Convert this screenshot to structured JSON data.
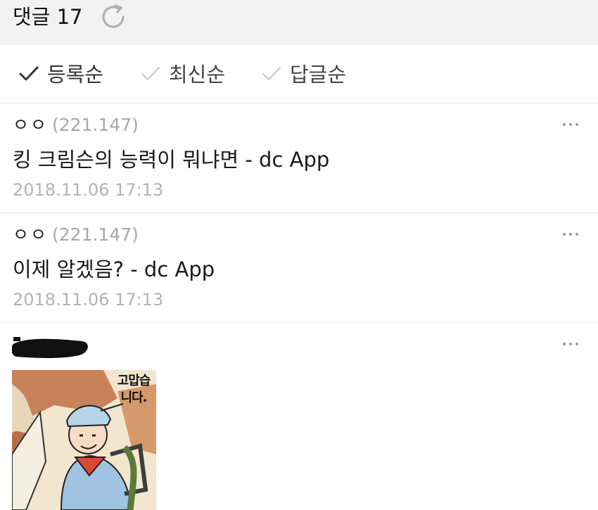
{
  "header": {
    "title": "댓글 17",
    "refresh_icon": "refresh-icon"
  },
  "sort": {
    "items": [
      {
        "label": "등록순",
        "active": true
      },
      {
        "label": "최신순",
        "active": false
      },
      {
        "label": "답글순",
        "active": false
      }
    ]
  },
  "comments": [
    {
      "author": "ㅇㅇ",
      "ip": "(221.147)",
      "text": "킹 크림슨의 능력이 뭐냐면  - dc App",
      "date": "2018.11.06 17:13",
      "more_icon": "more-icon"
    },
    {
      "author": "ㅇㅇ",
      "ip": "(221.147)",
      "text": "이제 알겠음?  - dc App",
      "date": "2018.11.06 17:13",
      "more_icon": "more-icon"
    },
    {
      "author_redacted": true,
      "image": {
        "caption": "고맙습\n니다."
      },
      "more_icon": "more-icon"
    }
  ],
  "colors": {
    "header_bg": "#f2f2f2",
    "muted_text": "#a8a8a8",
    "divider": "#e6e6e6"
  }
}
